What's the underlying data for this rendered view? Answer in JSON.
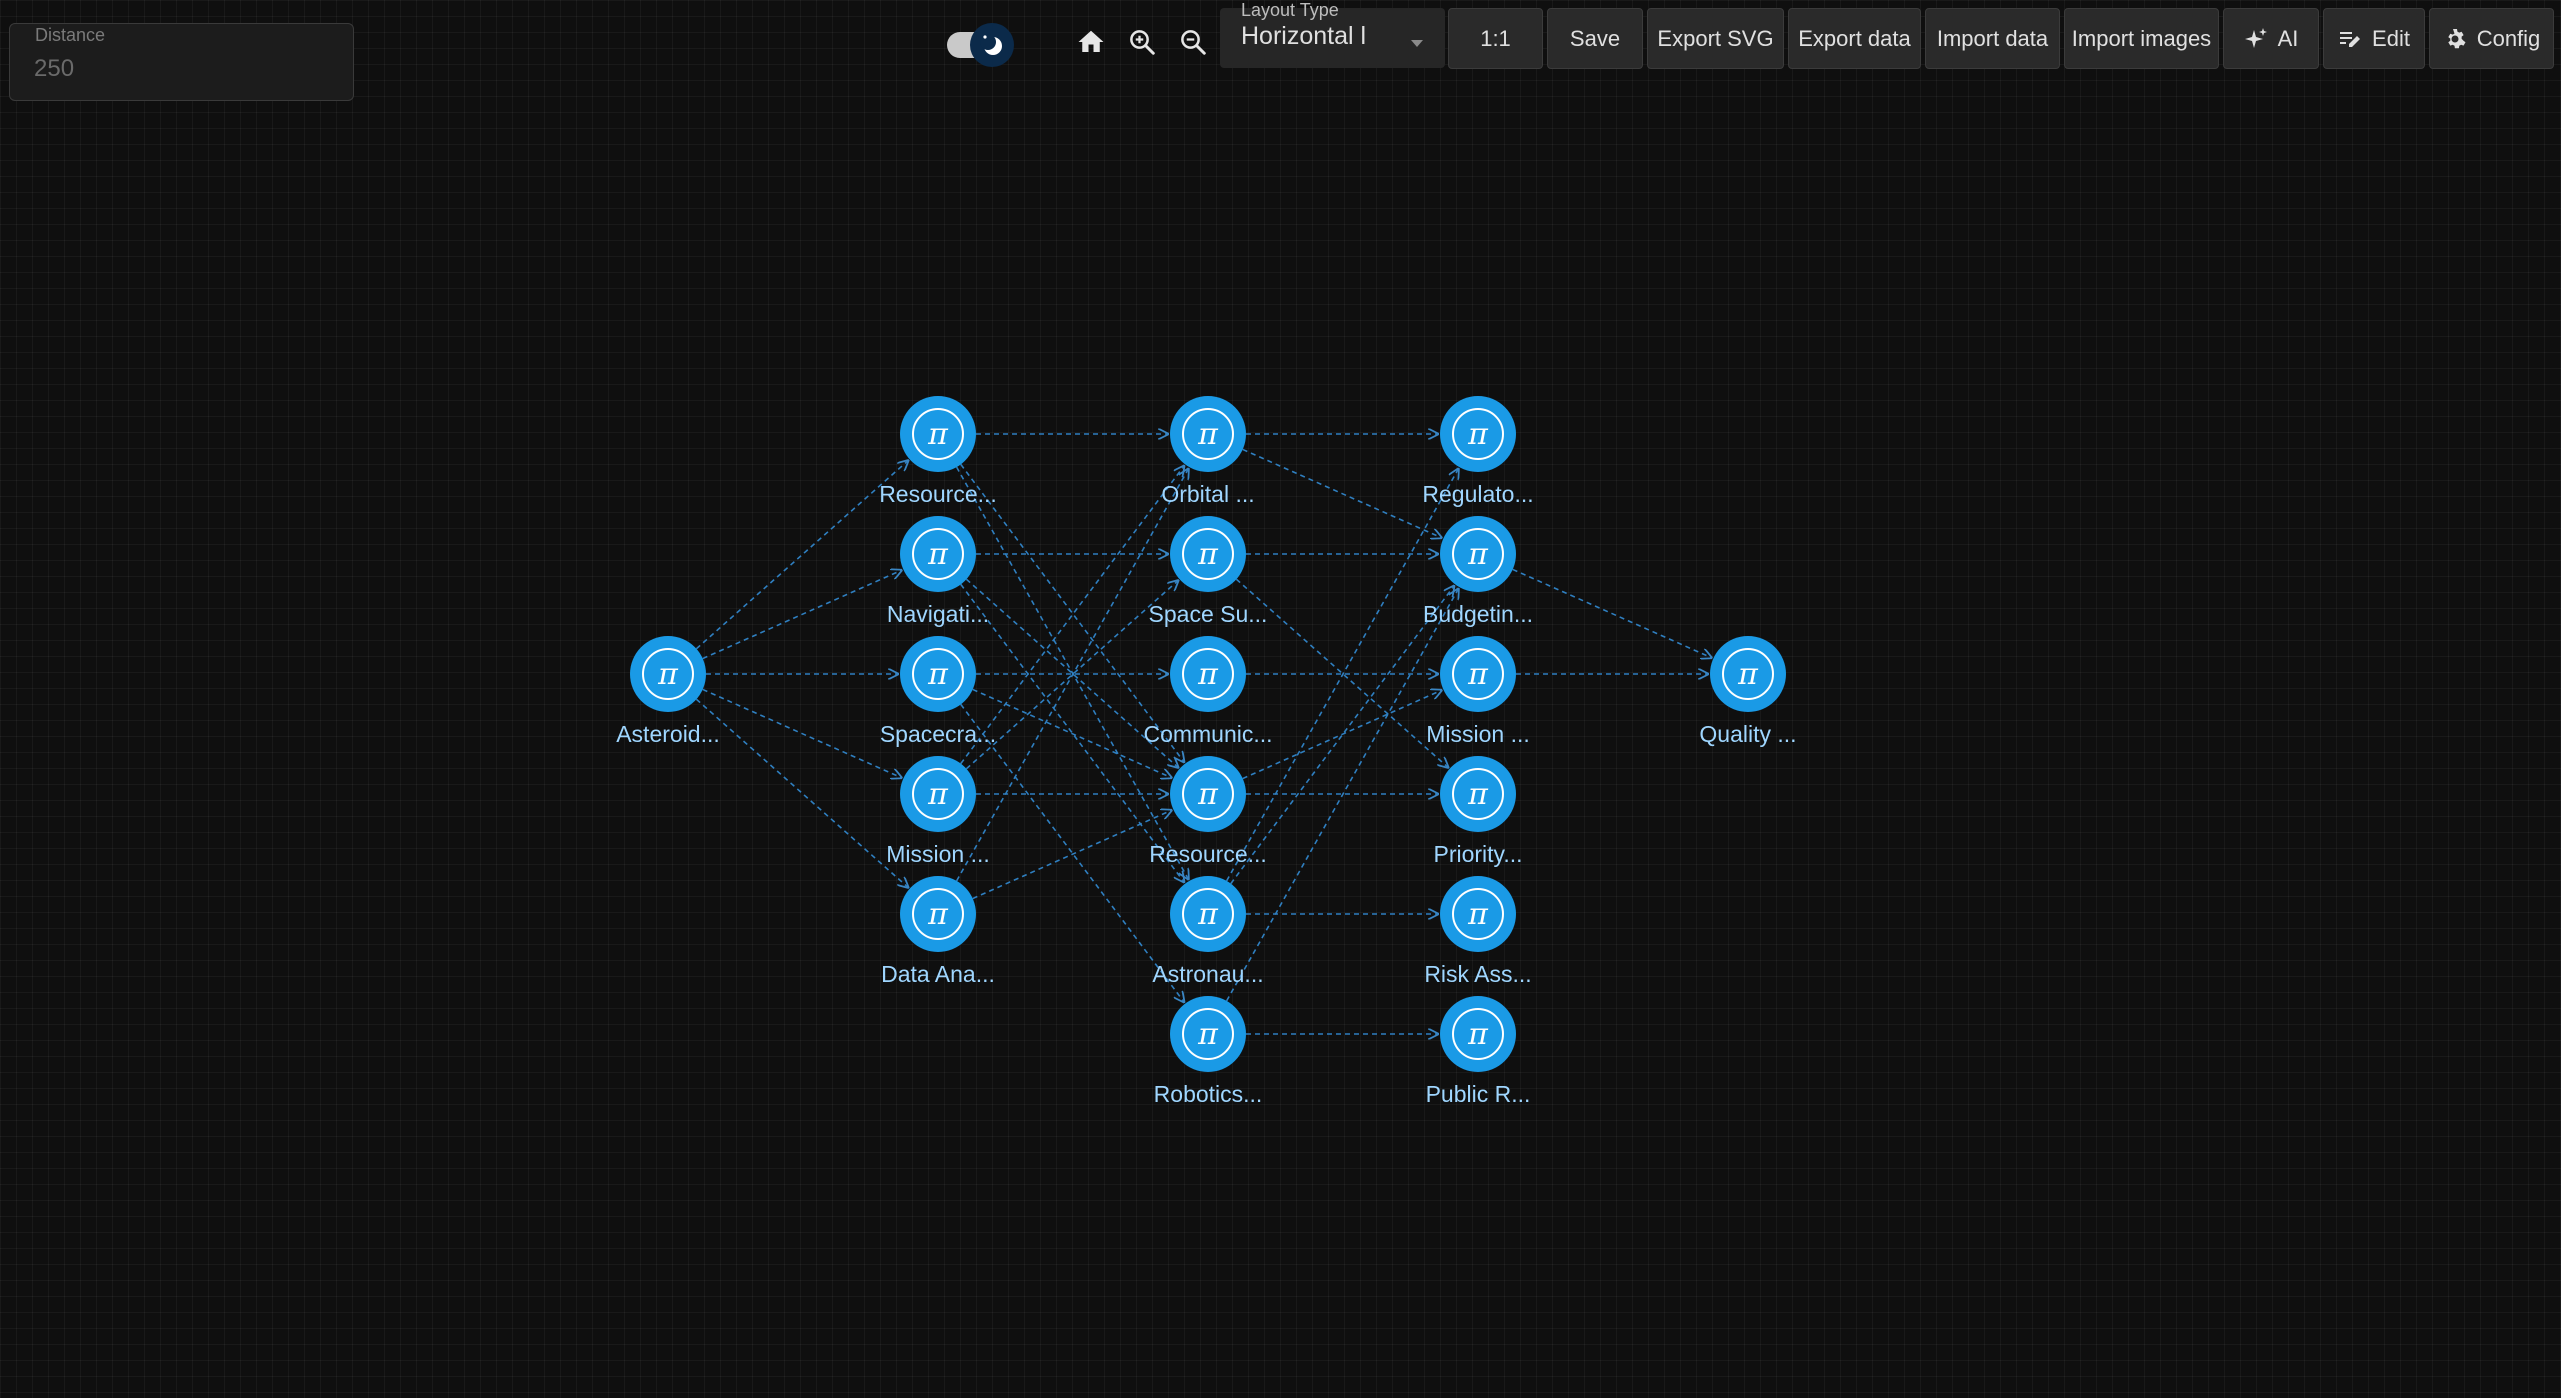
{
  "distance": {
    "label": "Distance",
    "value": "250"
  },
  "toolbar": {
    "layout_label": "Layout Type",
    "layout_value": "Horizontal l",
    "reset_label": "1:1",
    "save_label": "Save",
    "export_svg_label": "Export SVG",
    "export_data_label": "Export data",
    "import_data_label": "Import data",
    "import_images_label": "Import images",
    "ai_label": "AI",
    "edit_label": "Edit",
    "config_label": "Config"
  },
  "icons": {
    "toggle": "moon-icon",
    "home": "home-icon",
    "zoom_in": "zoom-in-icon",
    "zoom_out": "zoom-out-icon",
    "ai": "sparkle-icon",
    "edit": "edit-icon",
    "config": "gear-icon",
    "node": "pi-icon"
  },
  "colors": {
    "node_fill": "#1a9ae6",
    "node_ring": "#ffffff",
    "edge": "#2f7fc0",
    "label": "#9fd6ff",
    "background": "#0f0f0f"
  },
  "graph": {
    "node_glyph": "π",
    "nodes": [
      {
        "id": "a",
        "label": "Asteroid...",
        "column": 0,
        "row": 2
      },
      {
        "id": "b1",
        "label": "Resource...",
        "column": 1,
        "row": 0
      },
      {
        "id": "b2",
        "label": "Navigati...",
        "column": 1,
        "row": 1
      },
      {
        "id": "b3",
        "label": "Spacecra...",
        "column": 1,
        "row": 2
      },
      {
        "id": "b4",
        "label": "Mission ...",
        "column": 1,
        "row": 3
      },
      {
        "id": "b5",
        "label": "Data Ana...",
        "column": 1,
        "row": 4
      },
      {
        "id": "c1",
        "label": "Orbital ...",
        "column": 2,
        "row": 0
      },
      {
        "id": "c2",
        "label": "Space Su...",
        "column": 2,
        "row": 1
      },
      {
        "id": "c3",
        "label": "Communic...",
        "column": 2,
        "row": 2
      },
      {
        "id": "c4",
        "label": "Resource...",
        "column": 2,
        "row": 3
      },
      {
        "id": "c5",
        "label": "Astronau...",
        "column": 2,
        "row": 4
      },
      {
        "id": "c6",
        "label": "Robotics...",
        "column": 2,
        "row": 5
      },
      {
        "id": "d1",
        "label": "Regulato...",
        "column": 3,
        "row": 0
      },
      {
        "id": "d2",
        "label": "Budgetin...",
        "column": 3,
        "row": 1
      },
      {
        "id": "d3",
        "label": "Mission ...",
        "column": 3,
        "row": 2
      },
      {
        "id": "d4",
        "label": "Priority...",
        "column": 3,
        "row": 3
      },
      {
        "id": "d5",
        "label": "Risk Ass...",
        "column": 3,
        "row": 4
      },
      {
        "id": "d6",
        "label": "Public R...",
        "column": 3,
        "row": 5
      },
      {
        "id": "e",
        "label": "Quality ...",
        "column": 4,
        "row": 2
      }
    ],
    "edges": [
      [
        "a",
        "b1"
      ],
      [
        "a",
        "b2"
      ],
      [
        "a",
        "b3"
      ],
      [
        "a",
        "b4"
      ],
      [
        "a",
        "b5"
      ],
      [
        "b1",
        "c1"
      ],
      [
        "b1",
        "c4"
      ],
      [
        "b1",
        "c5"
      ],
      [
        "b2",
        "c2"
      ],
      [
        "b2",
        "c4"
      ],
      [
        "b2",
        "c5"
      ],
      [
        "b3",
        "c3"
      ],
      [
        "b3",
        "c4"
      ],
      [
        "b3",
        "c6"
      ],
      [
        "b4",
        "c1"
      ],
      [
        "b4",
        "c2"
      ],
      [
        "b4",
        "c4"
      ],
      [
        "b5",
        "c1"
      ],
      [
        "b5",
        "c4"
      ],
      [
        "c1",
        "d1"
      ],
      [
        "c1",
        "d2"
      ],
      [
        "c2",
        "d2"
      ],
      [
        "c2",
        "d4"
      ],
      [
        "c3",
        "d3"
      ],
      [
        "c4",
        "d3"
      ],
      [
        "c4",
        "d4"
      ],
      [
        "c5",
        "d1"
      ],
      [
        "c5",
        "d2"
      ],
      [
        "c5",
        "d5"
      ],
      [
        "c6",
        "d2"
      ],
      [
        "c6",
        "d6"
      ],
      [
        "d2",
        "e"
      ],
      [
        "d3",
        "e"
      ]
    ]
  }
}
